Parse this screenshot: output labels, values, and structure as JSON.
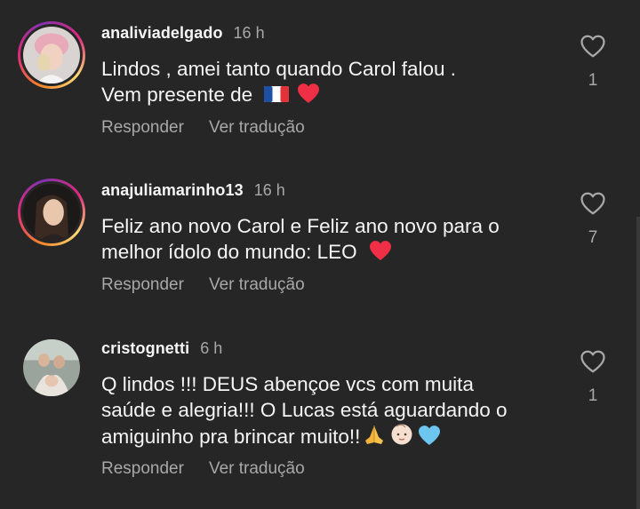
{
  "comments": [
    {
      "username": "analiviadelgado",
      "time": "16 h",
      "text_lines": [
        "Lindos , amei tanto quando Carol falou .",
        "Vem presente de"
      ],
      "emojis": [
        "french-flag",
        "red-heart"
      ],
      "likes": "1",
      "reply_label": "Responder",
      "translate_label": "Ver tradução",
      "story_ring": true
    },
    {
      "username": "anajuliamarinho13",
      "time": "16 h",
      "text_lines": [
        "Feliz ano novo Carol e Feliz ano novo para o",
        "melhor  ídolo do mundo: LEO"
      ],
      "emojis": [
        "red-heart"
      ],
      "likes": "7",
      "reply_label": "Responder",
      "translate_label": "Ver tradução",
      "story_ring": true
    },
    {
      "username": "cristognetti",
      "time": "6 h",
      "text_lines": [
        "Q lindos !!! DEUS abençoe vcs com muita",
        "saúde e alegria!!! O Lucas está aguardando o",
        "amiguinho pra brincar muito!!"
      ],
      "emojis": [
        "folded-hands",
        "baby-face",
        "light-blue-heart"
      ],
      "likes": "1",
      "reply_label": "Responder",
      "translate_label": "Ver tradução",
      "story_ring": false
    }
  ],
  "colors": {
    "background": "#262626",
    "primary_text": "#f5f5f5",
    "secondary_text": "#a8a8a8",
    "heart_red": "#e0245e",
    "heart_blue": "#6cc6f0"
  }
}
